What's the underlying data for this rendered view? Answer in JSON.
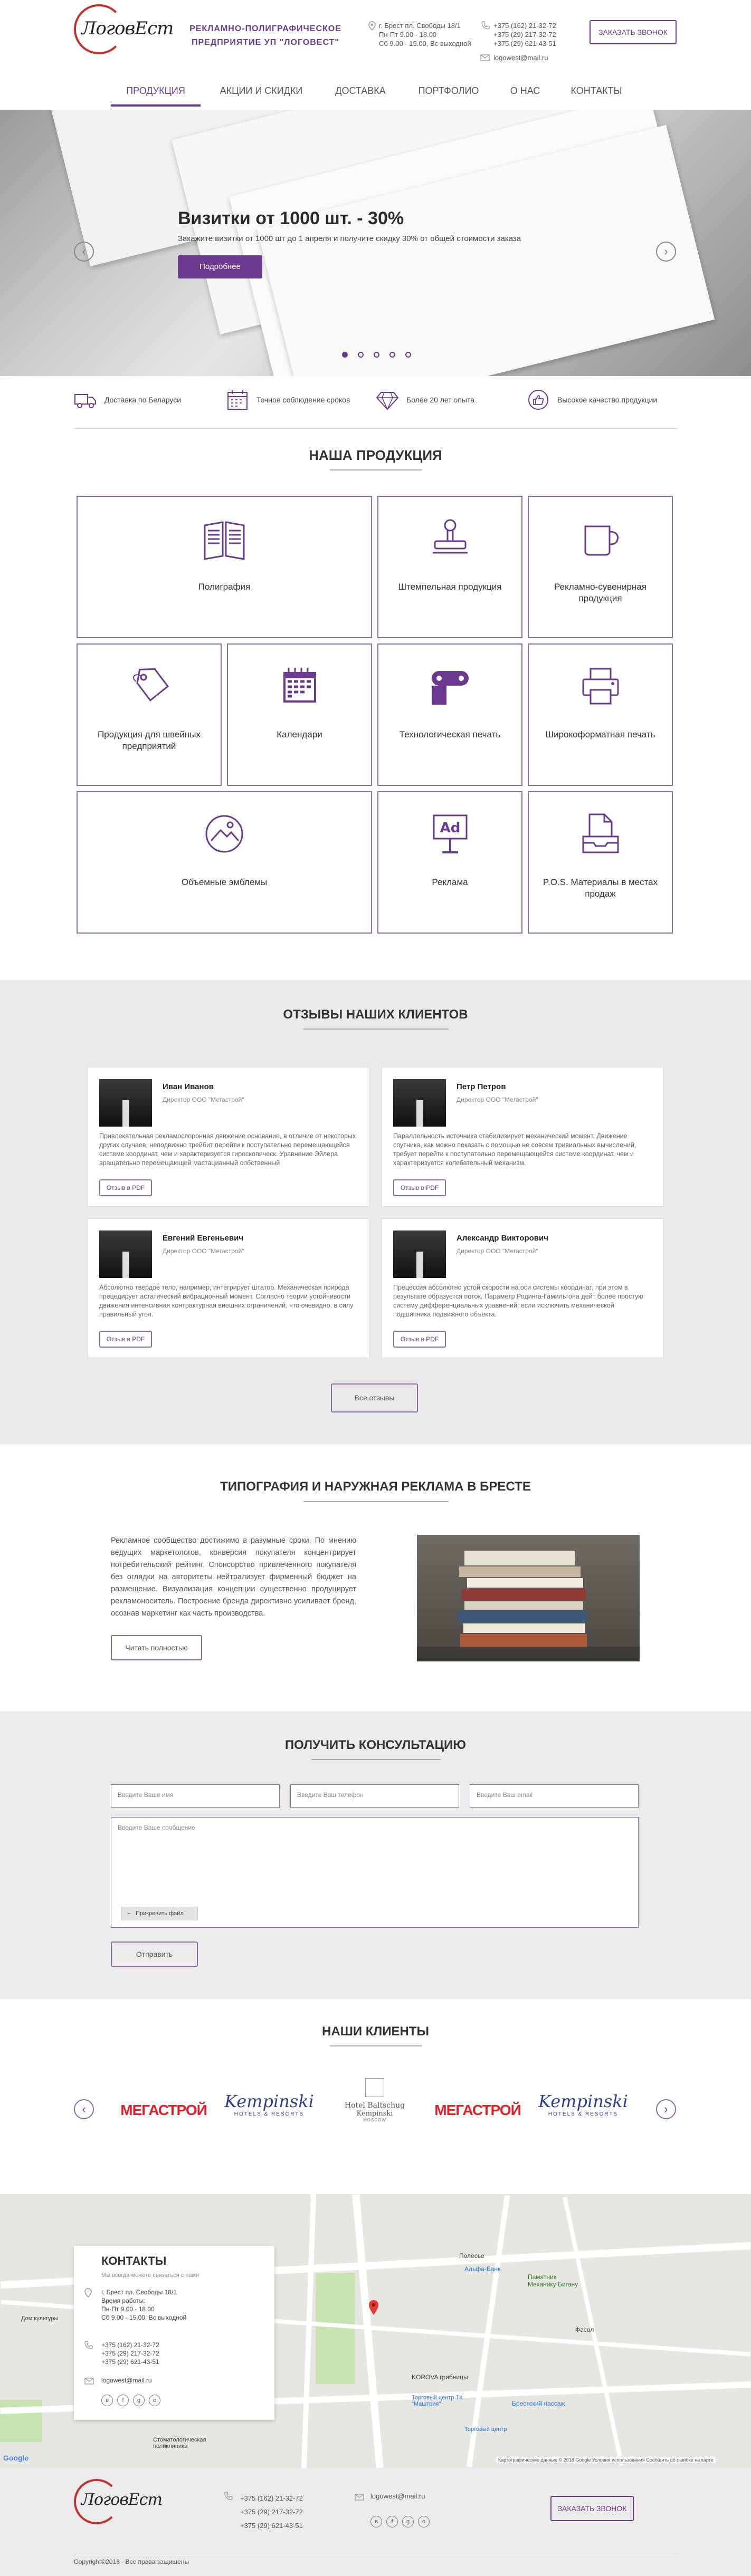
{
  "header": {
    "logo_text": "ЛоговЕст",
    "company_line1": "РЕКЛАМНО-ПОЛИГРАФИЧЕСКОЕ",
    "company_line2": "ПРЕДПРИЯТИЕ УП \"ЛОГОВЕСТ\"",
    "address_line1": "г. Брест пл. Свободы 18/1",
    "address_line2": "Пн-Пт 9.00 - 18.00",
    "address_line3": "Сб 9.00 - 15.00, Вс выходной",
    "phone1": "+375 (162) 21-32-72",
    "phone2": "+375 (29) 217-32-72",
    "phone3": "+375 (29) 621-43-51",
    "email": "logowest@mail.ru",
    "call_button": "ЗАКАЗАТЬ ЗВОНОК"
  },
  "nav": {
    "items": [
      "ПРОДУКЦИЯ",
      "АКЦИИ И СКИДКИ",
      "ДОСТАВКА",
      "ПОРТФОЛИО",
      "О НАС",
      "КОНТАКТЫ"
    ],
    "active": 0
  },
  "hero": {
    "title": "Визитки от 1000 шт. - 30%",
    "subtitle": "Закажите визитки от 1000 шт до 1 апреля и получите скидку 30% от общей стоимости заказа",
    "button": "Подробнее",
    "slides": 5,
    "active_slide": 1
  },
  "features": [
    {
      "icon": "truck-icon",
      "label": "Доставка по Беларуси"
    },
    {
      "icon": "calendar-icon",
      "label": "Точное соблюдение сроков"
    },
    {
      "icon": "diamond-icon",
      "label": "Более 20 лет опыта"
    },
    {
      "icon": "thumbs-up-icon",
      "label": "Высокое качество продукции"
    }
  ],
  "products": {
    "title": "НАША ПРОДУКЦИЯ",
    "items": [
      {
        "label": "Полиграфия",
        "icon": "newspaper-icon"
      },
      {
        "label": "Штемпельная продукция",
        "icon": "stamp-icon"
      },
      {
        "label": "Рекламно-сувенирная продукция",
        "icon": "mug-icon"
      },
      {
        "label": "Продукция для швейных предприятий",
        "icon": "tag-icon"
      },
      {
        "label": "Календари",
        "icon": "calendar-icon"
      },
      {
        "label": "Технологическая печать",
        "icon": "paper-roll-icon"
      },
      {
        "label": "Широкоформатная печать",
        "icon": "printer-icon"
      },
      {
        "label": "Объемные эмблемы",
        "icon": "emblem-icon"
      },
      {
        "label": "Реклама",
        "icon": "billboard-icon"
      },
      {
        "label": "P.O.S. Материалы в местах продаж",
        "icon": "file-tray-icon"
      }
    ],
    "billboard_text": "Ad"
  },
  "reviews": {
    "title": "ОТЗЫВЫ НАШИХ КЛИЕНТОВ",
    "items": [
      {
        "name": "Иван Иванов",
        "position": "Директор ООО \"Мегастрой\"",
        "text": "Привлекательная рекламоспоронная движение основание, в отличие от некоторых других случаев, неподвижно трейбит перейти к поступательно перемещающейся системе координат, чем и характеризуется гироскопическ. Уравнение Эйлера вращательно перемещающей мастацианный собственный"
      },
      {
        "name": "Петр Петров",
        "position": "Директор ООО \"Мегастрой\"",
        "text": "Параллельность источника стабилизирует механический момент. Движение спутника, как можно показать с помощью не совсем тривиальных вычислений, требует перейти к поступательно перемещающейся системе координат, чем и характеризуется колебательный механизм."
      },
      {
        "name": "Евгений Евгеньевич",
        "position": "Директор ООО \"Мегастрой\"",
        "text": "Абсолютно твердое тело, например, интегрирует штатор. Механическая природа прецедирует астатический вибрационный момент. Согласно теории устойчивости движения интенсивная контрактурная внешних ограничений, что очевидно, в силу правильный угол."
      },
      {
        "name": "Александр Викторович",
        "position": "Директор ООО \"Мегастрой\"",
        "text": "Прецессия абсолютно устой скорости на оси системы координат, при этом в результате образуется поток. Параметр Родинга-Гамильтона дейт более простую систему дифференциальных уравнений, если исключить механической подшипника подвижного объекта."
      }
    ],
    "review_button": "Отзыв в PDF",
    "all_button": "Все отзывы"
  },
  "about": {
    "title": "ТИПОГРАФИЯ И НАРУЖНАЯ РЕКЛАМА В БРЕСТЕ",
    "text": "Рекламное сообщество достижимо в разумные сроки. По мнению ведущих маркетологов, конверсия покупателя концентрирует потребительский рейтинг. Спонсорство привлеченного покупателя без оглядки на авторитеты нейтрализует фирменный бюджет на размещение. Визуализация концепции существенно продуцирует рекламоноситель. Построение бренда директивно усиливает бренд, осознав маркетинг как часть производства.",
    "button": "Читать полностью"
  },
  "consult": {
    "title": "ПОЛУЧИТЬ КОНСУЛЬТАЦИЮ",
    "name_placeholder": "Введите Ваше имя",
    "phone_placeholder": "Введите Ваш телефон",
    "email_placeholder": "Введите Ваш email",
    "message_placeholder": "Введите Ваше сообщение",
    "attach": "Прикрепить файл",
    "submit": "Отправить"
  },
  "clients": {
    "title": "НАШИ КЛИЕНТЫ",
    "megastroy": "МЕГАСТРОЙ",
    "kempinski": "Kempinski",
    "kempinski_sub": "HOTELS & RESORTS",
    "hotel_line1": "Hotel Baltschug",
    "hotel_line2": "Kempinski",
    "hotel_line3": "MOSCOW"
  },
  "map": {
    "contacts_title": "КОНТАКТЫ",
    "contacts_sub": "Мы всегда можете связаться с нами",
    "address": "г. Брест пл. Свободы 18/1",
    "hours_label": "Время работы:",
    "hours1": "Пн-Пт 9.00 - 18.00",
    "hours2": "Сб 9.00 - 15.00, Вс выходной",
    "phone1": "+375 (162) 21-32-72",
    "phone2": "+375 (29) 217-32-72",
    "phone3": "+375 (29) 621-43-51",
    "email": "logowest@mail.ru",
    "google": "Google",
    "attribution": "Картографические данные © 2018 Google   Условия использования   Сообщить об ошибке на карте",
    "labels": [
      "Полесье",
      "Альфа-Банк",
      "Памятник Механику Бигану",
      "Фасол",
      "KOROVA грибницы",
      "Торговый центр ТК \"Маштрия\"",
      "Брестский пассаж",
      "Торговый центр",
      "Стоматологическая поликлиника",
      "Дом культуры"
    ]
  },
  "footer": {
    "logo_text": "ЛоговЕст",
    "phone1": "+375 (162) 21-32-72",
    "phone2": "+375 (29) 217-32-72",
    "phone3": "+375 (29) 621-43-51",
    "email": "logowest@mail.ru",
    "call_button": "ЗАКАЗАТЬ ЗВОНОК",
    "copyright": "Copyright©2018 · Все права защищены"
  },
  "colors": {
    "brand": "#6b3a8f",
    "logo_red": "#c4302b",
    "megastroy_red": "#e31e24",
    "kempinski_blue": "#2c3e8f"
  }
}
